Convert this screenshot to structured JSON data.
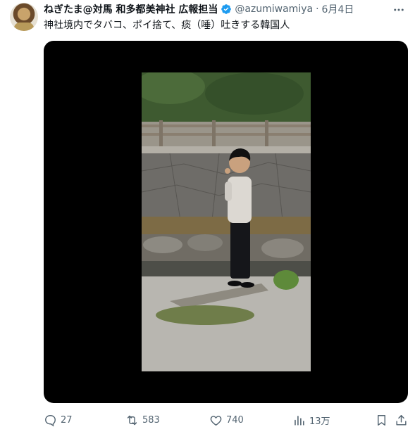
{
  "tweet": {
    "display_name": "ねぎたま@対馬 和多都美神社 広報担当",
    "handle": "@azumiwamiya",
    "separator": "·",
    "date": "6月4日",
    "text": "神社境内でタバコ、ポイ捨て、痰（唾）吐きする韓国人"
  },
  "metrics": {
    "replies": "27",
    "retweets": "583",
    "likes": "740",
    "views": "13万"
  },
  "colors": {
    "verified": "#1d9bf0",
    "secondary_text": "#536471",
    "media_bg": "#000000"
  },
  "icons": [
    "more-icon",
    "verified-icon",
    "reply-icon",
    "retweet-icon",
    "like-icon",
    "views-icon",
    "bookmark-icon",
    "share-icon"
  ]
}
